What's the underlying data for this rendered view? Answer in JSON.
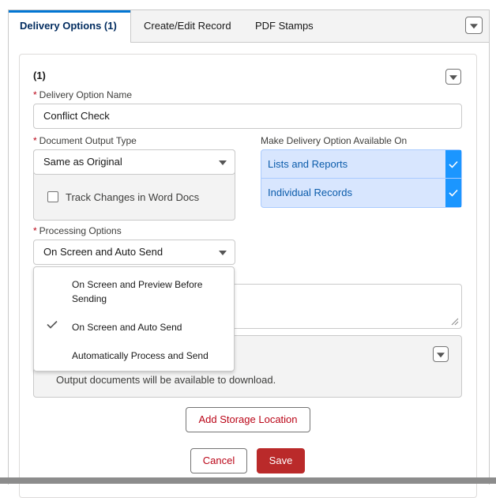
{
  "tabs": [
    {
      "label": "Delivery Options (1)",
      "active": true
    },
    {
      "label": "Create/Edit Record",
      "active": false
    },
    {
      "label": "PDF Stamps",
      "active": false
    }
  ],
  "card": {
    "heading": "(1)",
    "delivery_option_name": {
      "label": "Delivery Option Name",
      "required": true,
      "value": "Conflict Check"
    },
    "document_output_type": {
      "label": "Document Output Type",
      "required": true,
      "value": "Same as Original"
    },
    "track_changes": {
      "label": "Track Changes in Word Docs",
      "checked": false
    },
    "available_on": {
      "label": "Make Delivery Option Available On",
      "items": [
        {
          "label": "Lists and Reports",
          "selected": true
        },
        {
          "label": "Individual Records",
          "selected": true
        }
      ]
    },
    "processing_options": {
      "label": "Processing Options",
      "required": true,
      "value": "On Screen and Auto Send",
      "options": [
        {
          "label": "On Screen and Preview Before Sending",
          "selected": false
        },
        {
          "label": "On Screen and Auto Send",
          "selected": true
        },
        {
          "label": "Automatically Process and Send",
          "selected": false
        }
      ]
    },
    "download_note": "Output documents will be available to download.",
    "add_storage_label": "Add Storage Location",
    "cancel_label": "Cancel",
    "save_label": "Save"
  },
  "colors": {
    "accent": "#0176d3",
    "brand_button": "#ba2a2a",
    "selected_bg": "#d8e6fe",
    "check_bg": "#1b96ff",
    "required": "#ba0517"
  }
}
